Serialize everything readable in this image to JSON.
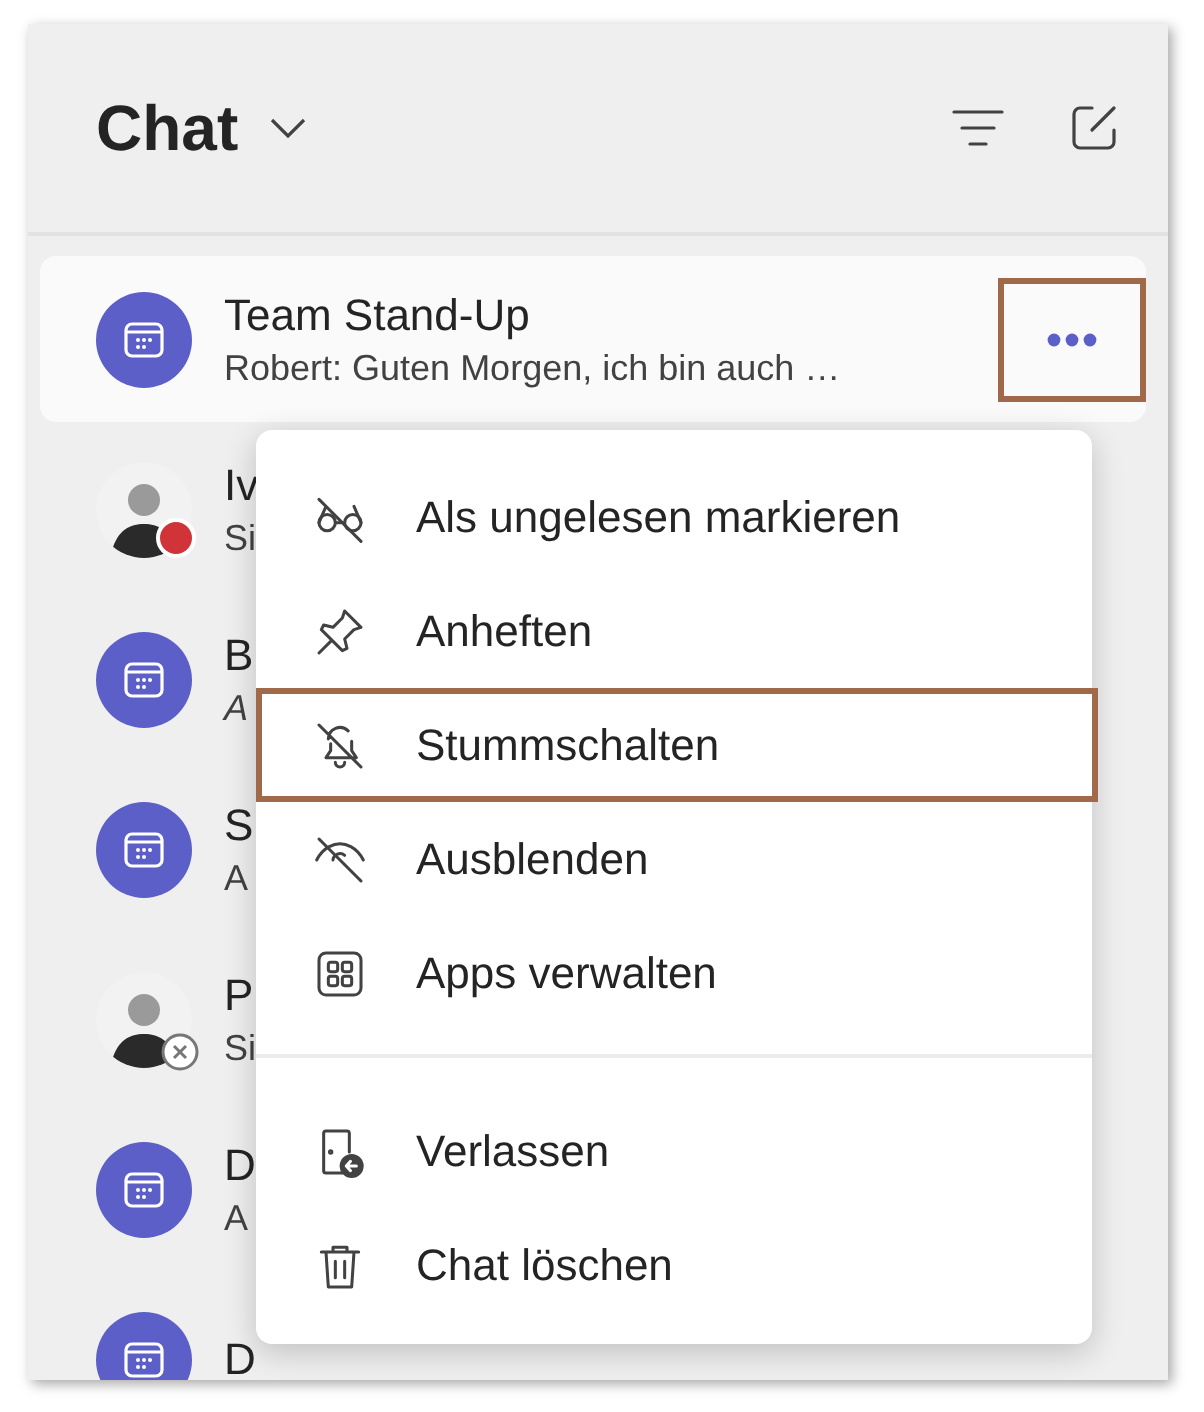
{
  "header": {
    "title": "Chat"
  },
  "chats": [
    {
      "kind": "meeting",
      "name": "Team Stand-Up",
      "preview": "Robert: Guten Morgen, ich bin auch …",
      "italic": false,
      "selected": true
    },
    {
      "kind": "busy",
      "name": "Iv",
      "preview": "Si",
      "italic": false,
      "selected": false
    },
    {
      "kind": "meeting",
      "name": "B",
      "preview": "A",
      "italic": true,
      "selected": false
    },
    {
      "kind": "meeting",
      "name": "S",
      "preview": "A",
      "italic": false,
      "selected": false
    },
    {
      "kind": "offline",
      "name": "P",
      "preview": "Si",
      "italic": false,
      "selected": false
    },
    {
      "kind": "meeting",
      "name": "D",
      "preview": "A",
      "italic": false,
      "selected": false
    },
    {
      "kind": "meeting",
      "name": "D",
      "selected": false
    }
  ],
  "more_button": {
    "highlighted": true
  },
  "menu": {
    "groups": [
      [
        {
          "label": "Als ungelesen markieren",
          "highlighted": false
        },
        {
          "label": "Anheften",
          "highlighted": false
        },
        {
          "label": "Stummschalten",
          "highlighted": true
        },
        {
          "label": "Ausblenden",
          "highlighted": false
        },
        {
          "label": "Apps verwalten",
          "highlighted": false
        }
      ],
      [
        {
          "label": "Verlassen",
          "highlighted": false
        },
        {
          "label": "Chat löschen",
          "highlighted": false
        }
      ]
    ]
  }
}
